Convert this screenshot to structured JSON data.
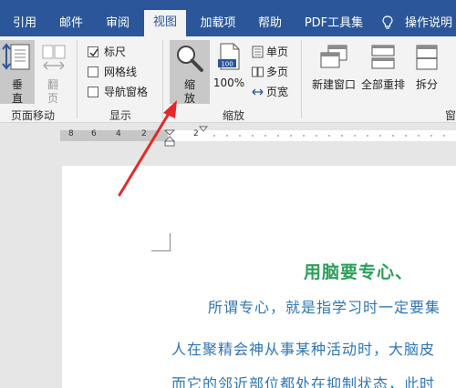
{
  "tabs": [
    {
      "label": "引用",
      "active": false
    },
    {
      "label": "邮件",
      "active": false
    },
    {
      "label": "审阅",
      "active": false
    },
    {
      "label": "视图",
      "active": true
    },
    {
      "label": "加载项",
      "active": false
    },
    {
      "label": "帮助",
      "active": false
    },
    {
      "label": "PDF工具集",
      "active": false
    }
  ],
  "tell_me": "操作说明搜",
  "ribbon": {
    "page_move": {
      "vertical_label": "垂\n直",
      "vertical_l1": "垂",
      "vertical_l2": "直",
      "flip_l1": "翻",
      "flip_l2": "页",
      "group_label": "页面移动"
    },
    "show": {
      "ruler": {
        "label": "标尺",
        "checked": true
      },
      "gridlines": {
        "label": "网格线",
        "checked": false
      },
      "nav_pane": {
        "label": "导航窗格",
        "checked": false
      },
      "group_label": "显示"
    },
    "zoom": {
      "zoom_l1": "缩",
      "zoom_l2": "放",
      "percent_icon_text": "100",
      "percent_label": "100%",
      "one_page": "单页",
      "multi_page": "多页",
      "page_width": "页宽",
      "group_label": "缩放"
    },
    "window": {
      "new_window": "新建窗口",
      "arrange_all": "全部重排",
      "split": "拆分",
      "group_label": "窗"
    }
  },
  "ruler_numbers": [
    "8",
    "6",
    "4",
    "2",
    "2"
  ],
  "document": {
    "title": "用脑要专心、",
    "line1": "所谓专心，就是指学习时一定要集",
    "line2": "人在聚精会神从事某种活动时，大脑皮",
    "line3": "而它的邻近部位都处在抑制状态，此时"
  },
  "colors": {
    "tab_bar": "#2b579a",
    "ribbon_bg": "#f3f3f3",
    "doc_title": "#2ca05a",
    "doc_text": "#2e75b6",
    "arrow": "#e8272a"
  }
}
